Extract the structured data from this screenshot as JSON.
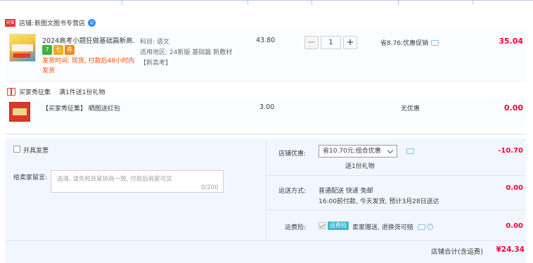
{
  "shop": {
    "badge": "天猫",
    "label": "店铺:",
    "name": "新图文图书专营店",
    "ww_icon": "chat-bubble-icon"
  },
  "item": {
    "title": "2024高考小题狂做基础篇新高...",
    "tags": [
      "7",
      "七",
      "券"
    ],
    "shipping": "发货时间: 现货, 付款后48小时内发货",
    "subject_label": "科目:",
    "subject": "语文",
    "region_label": "适用地区:",
    "region": "24新版 基础篇 新教材",
    "region2": "【新高考】",
    "unit_price": "43.80",
    "quantity": "1",
    "minus": "−",
    "plus": "+",
    "saving": "省8.76:优惠促销",
    "total": "35.04"
  },
  "gift": {
    "title": "买家秀征集",
    "desc": "满1件送1份礼物",
    "item_name": "【买家秀征集】 晒图送红包",
    "price": "3.00",
    "discount": "无优惠",
    "total": "0.00"
  },
  "invoice": {
    "label": "开具发票"
  },
  "message": {
    "label": "给卖家留言:",
    "placeholder": "选填, 请先和商家协商一致, 付款后商家可见",
    "count": "0/200"
  },
  "shop_coupon": {
    "label": "店铺优惠:",
    "selected": "省10.70元:组合优惠",
    "note": "送1份礼物",
    "value": "-10.70"
  },
  "delivery": {
    "label": "运送方式:",
    "line1": "普通配送 快递 免邮",
    "line2": "16:00前付款, 今天发货, 预计3月28日送达",
    "value": "0.00"
  },
  "insurance": {
    "label": "运费险:",
    "tag": "运费险",
    "desc": "卖家赠送, 退换货可赔",
    "value": "0.00"
  },
  "summary": {
    "label": "店铺合计(含运费)",
    "value": "¥24.34"
  },
  "colors": {
    "accent_red": "#ff0036",
    "orange": "#ff5000",
    "panel_bg": "#f2f7ff",
    "blue": "#2d8cf0"
  }
}
